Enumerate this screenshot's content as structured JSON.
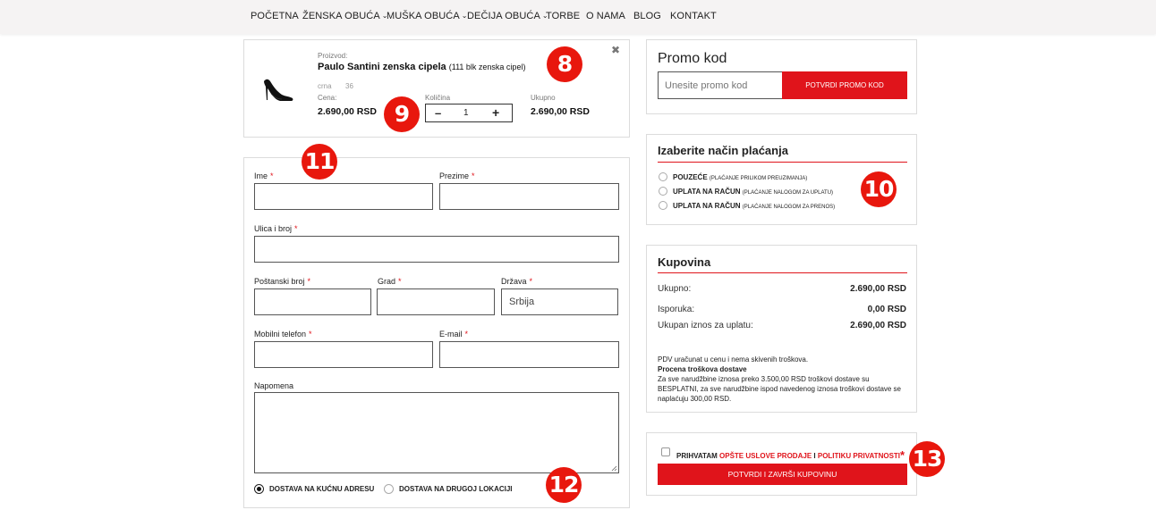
{
  "nav": {
    "items": [
      {
        "label": "POČETNA"
      },
      {
        "label": "ŽENSKA OBUĆA"
      },
      {
        "label": "MUŠKA OBUĆA"
      },
      {
        "label": "DEČIJA OBUĆA"
      },
      {
        "label": "TORBE"
      },
      {
        "label": "O NAMA"
      },
      {
        "label": "BLOG"
      },
      {
        "label": "KONTAKT"
      }
    ],
    "chevron": "⌄"
  },
  "cart": {
    "product_label": "Proizvod:",
    "product_name": "Paulo Santini zenska cipela",
    "product_code": "(111 blk zenska cipel)",
    "color": "crna",
    "size": "36",
    "price_label": "Cena:",
    "price": "2.690,00 RSD",
    "qty_label": "Količina",
    "qty_minus": "–",
    "qty_value": "1",
    "qty_plus": "+",
    "total_label": "Ukupno",
    "total": "2.690,00 RSD",
    "remove_icon": "✖"
  },
  "form": {
    "first_name": "Ime",
    "last_name": "Prezime",
    "street": "Ulica i broj",
    "postal": "Poštanski broj",
    "city": "Grad",
    "country": "Država",
    "country_value": "Srbija",
    "phone": "Mobilni telefon",
    "email": "E-mail",
    "note": "Napomena",
    "required_mark": "*",
    "delivery_home": "DOSTAVA NA KUĆNU ADRESU",
    "delivery_other": "DOSTAVA NA DRUGOJ LOKACIJI"
  },
  "promo": {
    "title": "Promo kod",
    "placeholder": "Unesite promo kod",
    "button": "POTVRDI PROMO KOD"
  },
  "payment": {
    "title": "Izaberite način plaćanja",
    "options": [
      {
        "label": "POUZEĆE",
        "sub": "(PLAĆANJE PRILIKOM PREUZIMANJA)"
      },
      {
        "label": "UPLATA NA RAČUN",
        "sub": "(PLAĆANJE NALOGOM ZA UPLATU)"
      },
      {
        "label": "UPLATA NA RAČUN",
        "sub": "(PLAĆANJE NALOGOM ZA PRENOS)"
      }
    ]
  },
  "summary": {
    "title": "Kupovina",
    "subtotal_label": "Ukupno:",
    "subtotal": "2.690,00 RSD",
    "shipping_label": "Isporuka:",
    "shipping": "0,00 RSD",
    "total_label": "Ukupan iznos za uplatu:",
    "total": "2.690,00 RSD",
    "vat_note": "PDV uračunat u cenu i nema skivenih troškova.",
    "shipping_title": "Procena troškova dostave",
    "shipping_note": "Za sve narudžbine iznosa preko 3.500,00 RSD troškovi dostave su BESPLATNI, za sve narudžbine ispod navedenog iznosa troškovi dostave se naplaćuju 300,00 RSD."
  },
  "terms": {
    "accept": "PRIHVATAM",
    "terms_link": "OPŠTE USLOVE PRODAJE",
    "and": "I",
    "privacy_link": "POLITIKU PRIVATNOSTI",
    "star": "*",
    "submit": "POTVRDI I ZAVRŠI KUPOVINU"
  },
  "badges": {
    "b8": "8",
    "b9": "9",
    "b10": "10",
    "b11": "11",
    "b12": "12",
    "b13": "13"
  },
  "colors": {
    "accent": "#e0141b",
    "badge": "#e8170d",
    "nav_bg": "#f5f3f3"
  }
}
